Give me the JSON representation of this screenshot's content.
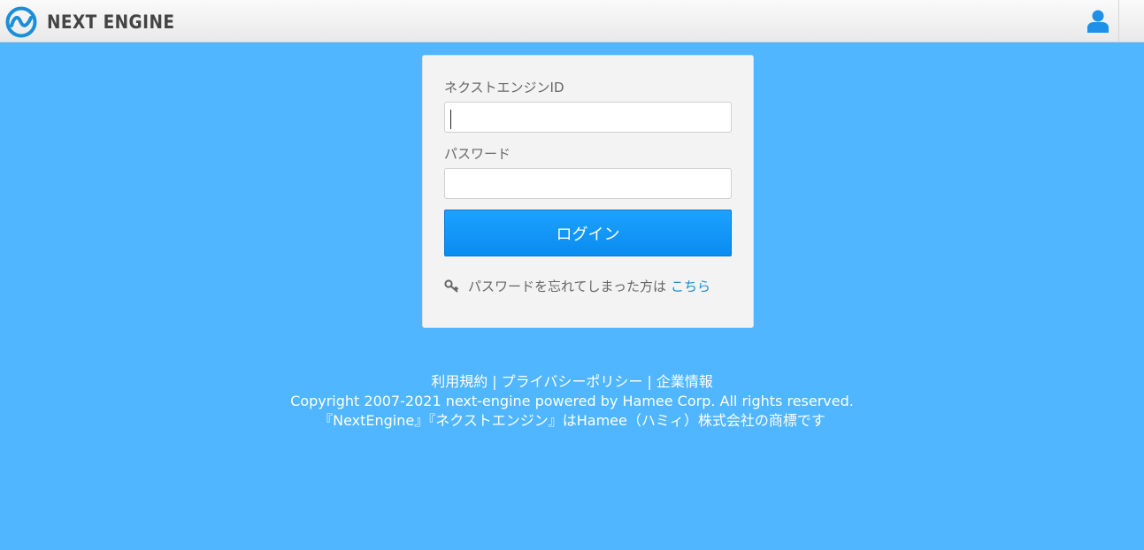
{
  "header": {
    "logo_text": "NEXT ENGINE",
    "brand_color": "#1a8ed8",
    "user_icon": "user-icon"
  },
  "login": {
    "id_label": "ネクストエンジンID",
    "id_value": "",
    "password_label": "パスワード",
    "password_value": "",
    "submit_label": "ログイン",
    "forgot_text": "パスワードを忘れてしまった方は",
    "forgot_link": "こちら",
    "forgot_icon": "key-icon"
  },
  "footer": {
    "links": [
      "利用規約",
      "プライバシーポリシー",
      "企業情報"
    ],
    "separator": "|",
    "copyright": "Copyright 2007-2021 next-engine powered by Hamee Corp. All rights reserved.",
    "trademark": "『NextEngine』『ネクストエンジン』はHamee（ハミィ）株式会社の商標です"
  },
  "colors": {
    "background": "#4fb6ff",
    "button": "#0a8cf0",
    "link": "#1e8ad8"
  }
}
